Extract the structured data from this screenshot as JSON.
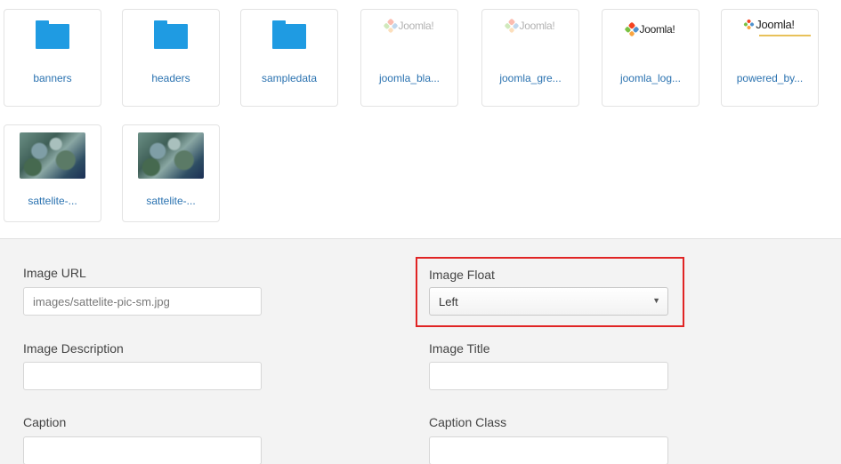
{
  "media": {
    "row1": [
      {
        "name": "banners",
        "kind": "folder"
      },
      {
        "name": "headers",
        "kind": "folder"
      },
      {
        "name": "sampledata",
        "kind": "folder"
      },
      {
        "name": "joomla_bla...",
        "kind": "image",
        "logo_text": "Joomla!",
        "faded": true
      },
      {
        "name": "joomla_gre...",
        "kind": "image",
        "logo_text": "Joomla!",
        "faded": true
      },
      {
        "name": "joomla_log...",
        "kind": "image",
        "logo_text": "Joomla!",
        "faded": false
      },
      {
        "name": "powered_by...",
        "kind": "image",
        "logo_text": "Joomla!",
        "faded": false
      }
    ],
    "row2": [
      {
        "name": "sattelite-...",
        "kind": "image"
      },
      {
        "name": "sattelite-...",
        "kind": "image"
      }
    ]
  },
  "form": {
    "image_url": {
      "label": "Image URL",
      "value": "images/sattelite-pic-sm.jpg"
    },
    "image_float": {
      "label": "Image Float",
      "selected": "Left"
    },
    "image_description": {
      "label": "Image Description",
      "value": ""
    },
    "image_title": {
      "label": "Image Title",
      "value": ""
    },
    "caption": {
      "label": "Caption",
      "value": ""
    },
    "caption_class": {
      "label": "Caption Class",
      "value": ""
    }
  },
  "colors": {
    "folder": "#1f9be2",
    "link": "#2a72b0",
    "highlight": "#e02424"
  }
}
